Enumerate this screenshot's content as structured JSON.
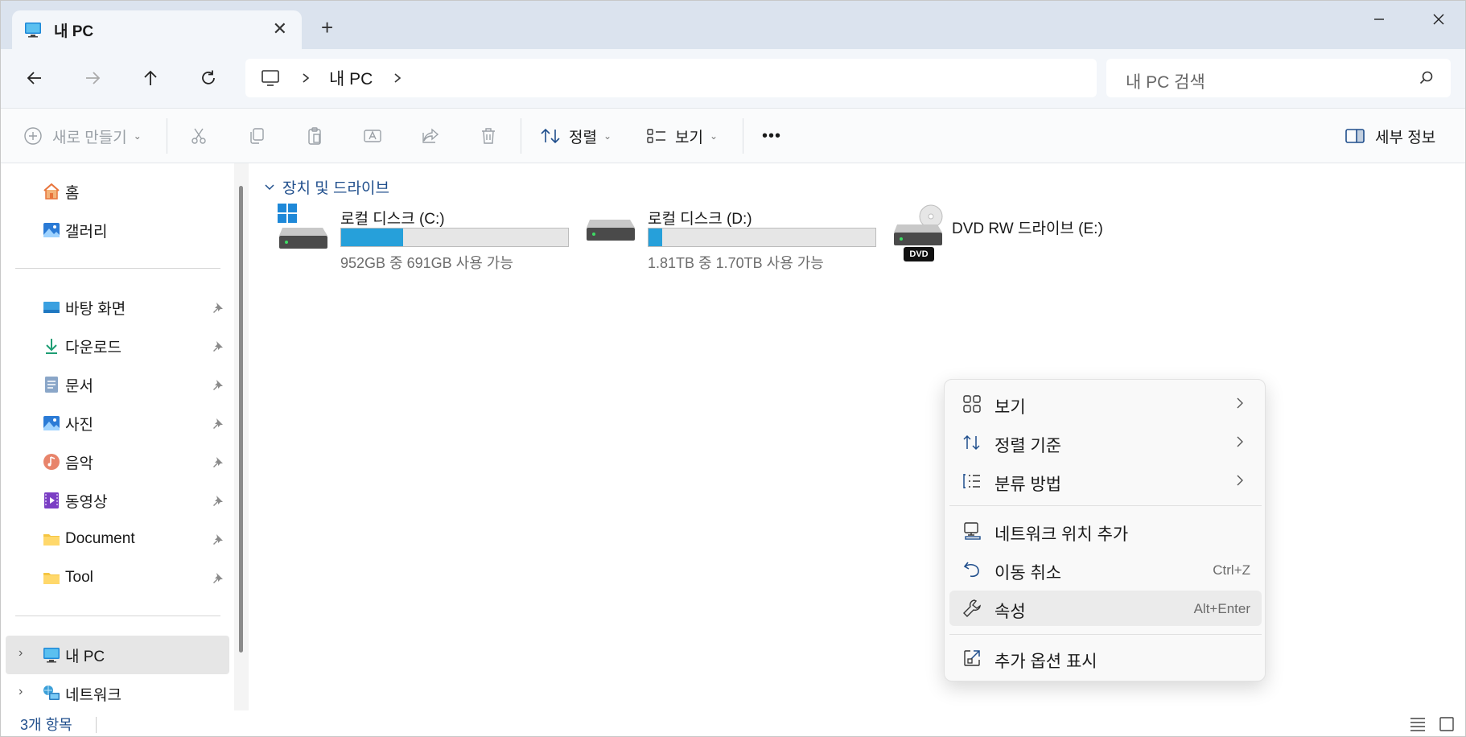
{
  "window": {
    "tab_title": "내 PC",
    "tab_icon": "monitor-icon",
    "new_tab": "+",
    "controls": [
      "minimize-icon",
      "maximize-icon",
      "close-icon"
    ]
  },
  "address": {
    "breadcrumbs": [
      "내 PC"
    ],
    "search_placeholder": "내 PC 검색"
  },
  "commandbar": {
    "new_label": "새로 만들기",
    "sort_label": "정렬",
    "view_label": "보기",
    "more_label": "•••",
    "details_label": "세부 정보"
  },
  "sidebar": {
    "top": [
      {
        "label": "홈",
        "icon": "home-icon"
      },
      {
        "label": "갤러리",
        "icon": "gallery-icon"
      }
    ],
    "pinned": [
      {
        "label": "바탕 화면",
        "icon": "desktop-icon"
      },
      {
        "label": "다운로드",
        "icon": "download-icon"
      },
      {
        "label": "문서",
        "icon": "document-icon"
      },
      {
        "label": "사진",
        "icon": "pictures-icon"
      },
      {
        "label": "음악",
        "icon": "music-icon"
      },
      {
        "label": "동영상",
        "icon": "video-icon"
      },
      {
        "label": "Document",
        "icon": "folder-icon"
      },
      {
        "label": "Tool",
        "icon": "folder-icon"
      }
    ],
    "tree": [
      {
        "label": "내 PC",
        "icon": "monitor-icon",
        "selected": true
      },
      {
        "label": "네트워크",
        "icon": "network-icon",
        "selected": false
      }
    ]
  },
  "content": {
    "group_header": "장치 및 드라이브",
    "drives": [
      {
        "name": "로컬 디스크 (C:)",
        "info": "952GB 중 691GB 사용 가능",
        "used_fraction": 0.274
      },
      {
        "name": "로컬 디스크 (D:)",
        "info": "1.81TB 중 1.70TB 사용 가능",
        "used_fraction": 0.061
      },
      {
        "name": "DVD RW 드라이브 (E:)",
        "badge": "DVD"
      }
    ]
  },
  "context_menu": {
    "items": [
      {
        "label": "보기",
        "icon": "view-grid-icon",
        "submenu": true
      },
      {
        "label": "정렬 기준",
        "icon": "sort-icon",
        "submenu": true
      },
      {
        "label": "분류 방법",
        "icon": "group-list-icon",
        "submenu": true
      },
      {
        "label": "네트워크 위치 추가",
        "icon": "network-location-icon"
      },
      {
        "label": "이동 취소",
        "icon": "undo-icon",
        "shortcut": "Ctrl+Z"
      },
      {
        "label": "속성",
        "icon": "wrench-icon",
        "shortcut": "Alt+Enter"
      },
      {
        "label": "추가 옵션 표시",
        "icon": "open-external-icon"
      }
    ]
  },
  "status": {
    "item_count": "3개 항목"
  },
  "colors": {
    "accent": "#26a0da",
    "titlebar": "#dbe3ee",
    "link_blue": "#1f4e8c"
  }
}
